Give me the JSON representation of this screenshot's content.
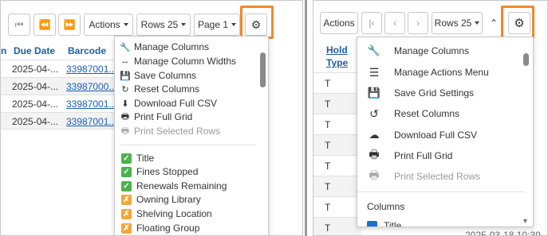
{
  "left": {
    "toolbar": {
      "first_icon": "first-page-icon",
      "prev_icon": "previous-page-icon",
      "next_icon": "next-page-icon",
      "actions_label": "Actions",
      "rows_label": "Rows 25",
      "page_label": "Page 1",
      "settings_icon": "gear-icon"
    },
    "columns": {
      "partial": "n",
      "due_date": "Due Date",
      "barcode": "Barcode"
    },
    "rows": [
      {
        "due": "2025-04-...",
        "barcode": "33987001..."
      },
      {
        "due": "2025-04-...",
        "barcode": "33987000..."
      },
      {
        "due": "2025-04-...",
        "barcode": "33987001..."
      },
      {
        "due": "2025-04-...",
        "barcode": "33987001..."
      }
    ],
    "menu": {
      "actions": [
        {
          "icon": "wrench-icon",
          "label": "Manage Columns"
        },
        {
          "icon": "resize-arrows-icon",
          "label": "Manage Column Widths"
        },
        {
          "icon": "save-icon",
          "label": "Save Columns"
        },
        {
          "icon": "refresh-icon",
          "label": "Reset Columns"
        },
        {
          "icon": "download-icon",
          "label": "Download Full CSV"
        },
        {
          "icon": "print-icon",
          "label": "Print Full Grid"
        },
        {
          "icon": "print-icon",
          "label": "Print Selected Rows",
          "disabled": true
        }
      ],
      "columns": [
        {
          "label": "Title",
          "checked": true
        },
        {
          "label": "Fines Stopped",
          "checked": true
        },
        {
          "label": "Renewals Remaining",
          "checked": true
        },
        {
          "label": "Owning Library",
          "checked": false
        },
        {
          "label": "Shelving Location",
          "checked": false
        },
        {
          "label": "Floating Group",
          "checked": false
        }
      ]
    }
  },
  "right": {
    "toolbar": {
      "actions_label": "Actions",
      "first_icon": "first-page-icon",
      "prev_icon": "chevron-left-icon",
      "next_icon": "chevron-right-icon",
      "rows_label": "Rows 25",
      "collapse_icon": "chevron-up-icon",
      "settings_icon": "gear-icon"
    },
    "header": {
      "line1": "Hold",
      "line2": "Type"
    },
    "rows": [
      "T",
      "T",
      "T",
      "T",
      "T",
      "T",
      "T",
      "T",
      "T"
    ],
    "footer_date": "2025-03-18 10:39",
    "menu": {
      "actions": [
        {
          "icon": "wrench-icon",
          "label": "Manage Columns"
        },
        {
          "icon": "hamburger-icon",
          "label": "Manage Actions Menu"
        },
        {
          "icon": "save-icon",
          "label": "Save Grid Settings"
        },
        {
          "icon": "history-icon",
          "label": "Reset Columns"
        },
        {
          "icon": "cloud-download-icon",
          "label": "Download Full CSV"
        },
        {
          "icon": "print-icon",
          "label": "Print Full Grid"
        },
        {
          "icon": "print-icon",
          "label": "Print Selected Rows",
          "disabled": true
        }
      ],
      "columns_heading": "Columns",
      "first_column": "Title"
    }
  },
  "colors": {
    "highlight": "#f0892a",
    "checked": "#4bb34b",
    "unchecked": "#f3a73c",
    "link": "#1a5fb4"
  }
}
